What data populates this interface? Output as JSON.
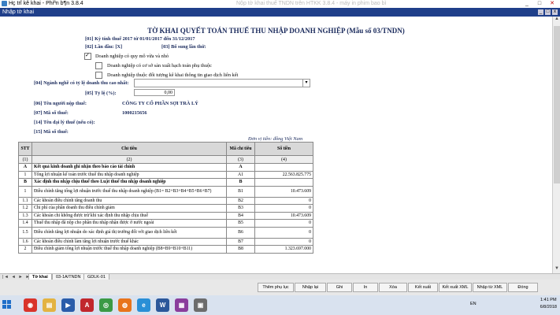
{
  "window": {
    "title": "Hç trî kê khai - Phiªn b¶n 3.8.4",
    "ghost_title": "Nộp tờ khai thuế TNDN trên HTKK 3.8.4 - máy in phim bao bì",
    "subwindow": "Nhập tờ khai",
    "min": "_",
    "max": "□",
    "close": "✕"
  },
  "form": {
    "heading": "TỜ KHAI QUYẾT TOÁN THUẾ THU NHẬP DOANH NGHIỆP (Mẫu số 03/TNDN)",
    "period": "[01] Kỳ tính thuế 2017 từ 01/01/2017 đến 31/12/2017",
    "first_label": "[02]     Lần đầu:     [X]",
    "supplement_label": "[03]     Bổ sung lần thứ:",
    "checkboxes": [
      {
        "label": "Doanh nghiệp có quy mô vừa và nhỏ",
        "checked": true
      },
      {
        "label": "Doanh nghiệp có cơ sở sản xuất hạch toán phụ thuộc",
        "checked": false
      },
      {
        "label": "Doanh nghiệp thuộc đối tượng kê khai thông tin giao dịch liên kết",
        "checked": false
      }
    ],
    "industry_label": "[04] Ngành nghề có tỷ lệ doanh thu cao nhất:",
    "industry_value": "",
    "rate_label": "[05] Tỷ lệ (%):",
    "rate_value": "0,00",
    "taxpayer_label": "[06] Tên người nộp thuế:",
    "taxpayer_value": "CÔNG TY CỔ PHẦN SỢI TRÀ LÝ",
    "tax_id_label": "[07] Mã số thuế:",
    "tax_id_value": "1000215656",
    "agent_label": "[14] Tên đại lý thuế (nếu có):",
    "agent_tax_label": "[15] Mã số thuế:",
    "currency_note": "Đơn vị tiền: đồng Việt Nam"
  },
  "table": {
    "headers": [
      "STT",
      "Chỉ tiêu",
      "Mã chỉ tiêu",
      "Số tiền"
    ],
    "index_row": [
      "(1)",
      "(2)",
      "(3)",
      "(4)"
    ],
    "rows": [
      {
        "stt": "A",
        "name": "Kết quả kinh doanh ghi nhận theo báo cáo tài chính",
        "code": "A",
        "amount": "",
        "section": true
      },
      {
        "stt": "1",
        "name": "Tổng lợi nhuận kế toán trước thuế thu nhập doanh nghiệp",
        "code": "A1",
        "amount": "22.563.825.775"
      },
      {
        "stt": "B",
        "name": "Xác định thu nhập chịu thuế theo Luật thuế thu nhập doanh nghiệp",
        "code": "B",
        "amount": "",
        "section": true
      },
      {
        "stt": "1",
        "name": "Điều chỉnh tăng tổng lợi nhuận trước thuế thu nhập doanh nghiệp (B1= B2+B3+B4+B5+B6+B7)",
        "code": "B1",
        "amount": "10.473.609",
        "tall": true
      },
      {
        "stt": "1.1",
        "name": "Các khoản điều chỉnh tăng doanh thu",
        "code": "B2",
        "amount": "0"
      },
      {
        "stt": "1.2",
        "name": "Chi phí của phần doanh thu điều chỉnh giảm",
        "code": "B3",
        "amount": "0"
      },
      {
        "stt": "1.3",
        "name": "Các khoản chi không được trừ khi xác định thu nhập chịu thuế",
        "code": "B4",
        "amount": "10.473.609"
      },
      {
        "stt": "1.4",
        "name": "Thuế thu nhập đã nộp cho phần thu nhập nhận được ở nước ngoài",
        "code": "B5",
        "amount": "0"
      },
      {
        "stt": "1.5",
        "name": "Điều chỉnh tăng lợi nhuận do xác định giá thị trường đối với giao dịch liên kết",
        "code": "B6",
        "amount": "0",
        "tall": true
      },
      {
        "stt": "1.6",
        "name": "Các khoản điều chỉnh làm tăng lợi nhuận trước thuế khác",
        "code": "B7",
        "amount": "0"
      },
      {
        "stt": "2",
        "name": "Điều chỉnh giảm tổng lợi nhuận trước thuế thu nhập doanh nghiệp (B8=B9+B10+B11)",
        "code": "B8",
        "amount": "1.323.697.000"
      }
    ]
  },
  "tabs": {
    "nav": "|◄ ◄ ► ►|",
    "items": [
      "Tờ khai",
      "03-1A/TNDN",
      "GDLK-01"
    ],
    "active": 0
  },
  "buttons": [
    "Thêm phụ lục",
    "Nhập lại",
    "Ghi",
    "In",
    "Xóa",
    "Kết xuất",
    "Kết xuất XML",
    "Nhập từ XML",
    "Đóng"
  ],
  "taskbar": {
    "lang": "EN",
    "time": "1:41 PM",
    "date": "6/8/2018",
    "apps": [
      {
        "name": "red-app",
        "color": "#d9342b",
        "glyph": "◉"
      },
      {
        "name": "file-explorer",
        "color": "#e3b341",
        "glyph": "▤"
      },
      {
        "name": "media",
        "color": "#2a5caa",
        "glyph": "▶"
      },
      {
        "name": "pdf",
        "color": "#c1272d",
        "glyph": "A"
      },
      {
        "name": "chrome",
        "color": "#3b9a45",
        "glyph": "◎"
      },
      {
        "name": "firefox",
        "color": "#e8741c",
        "glyph": "◍"
      },
      {
        "name": "ie",
        "color": "#2a8fd6",
        "glyph": "e"
      },
      {
        "name": "word",
        "color": "#2b579a",
        "glyph": "W"
      },
      {
        "name": "htkk",
        "color": "#8a3d9c",
        "glyph": "▦"
      },
      {
        "name": "misc",
        "color": "#6c6c6c",
        "glyph": "▣"
      }
    ]
  }
}
